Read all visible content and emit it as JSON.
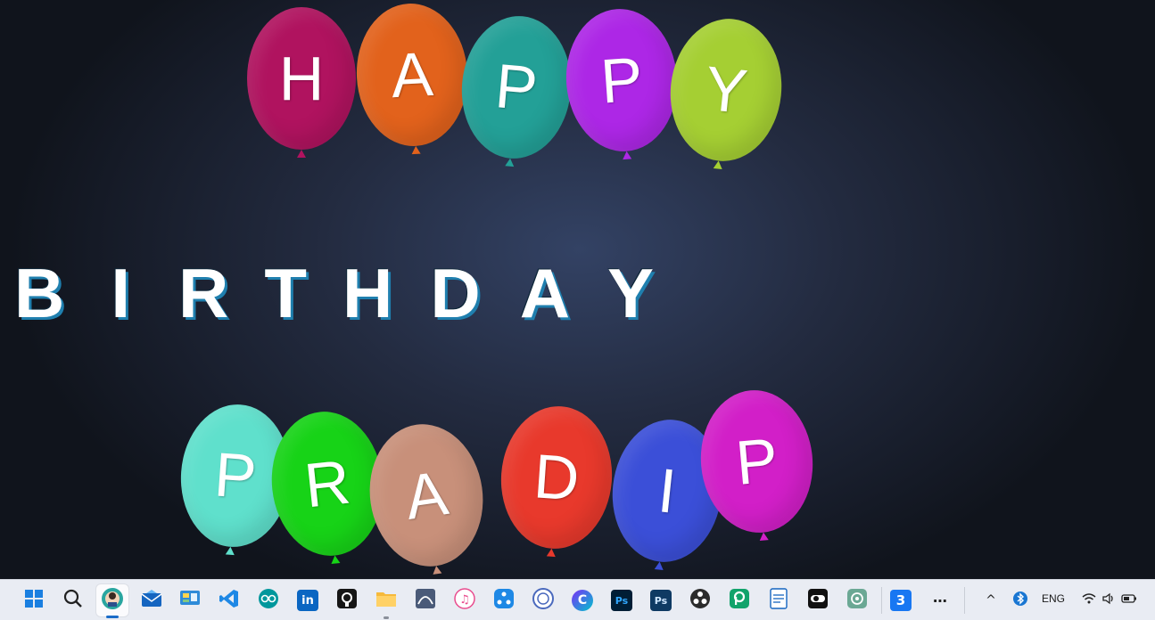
{
  "greeting": {
    "top_word": [
      {
        "letter": "H",
        "color": "#b0135f"
      },
      {
        "letter": "A",
        "color": "#e2621c"
      },
      {
        "letter": "P",
        "color": "#23a097"
      },
      {
        "letter": "P",
        "color": "#ad27e6"
      },
      {
        "letter": "Y",
        "color": "#a5cf33"
      }
    ],
    "middle_word": [
      "B",
      "I",
      "R",
      "T",
      "H",
      "D",
      "A",
      "Y"
    ],
    "bottom_word": [
      {
        "letter": "P",
        "color": "#5fe0cc"
      },
      {
        "letter": "R",
        "color": "#17d317"
      },
      {
        "letter": "A",
        "color": "#c8907a"
      },
      {
        "letter": "D",
        "color": "#e8392c"
      },
      {
        "letter": "I",
        "color": "#3b4fd8"
      },
      {
        "letter": "P",
        "color": "#d21fc8"
      }
    ]
  },
  "taskbar": {
    "apps": [
      {
        "name": "start-icon"
      },
      {
        "name": "search-icon"
      },
      {
        "name": "edge-profile-icon",
        "active": true
      },
      {
        "name": "mail-icon"
      },
      {
        "name": "control-panel-icon"
      },
      {
        "name": "vscode-icon"
      },
      {
        "name": "arduino-icon"
      },
      {
        "name": "linkedin-icon",
        "glyph": "in"
      },
      {
        "name": "github-icon"
      },
      {
        "name": "file-explorer-icon",
        "running": true
      },
      {
        "name": "wireshark-icon"
      },
      {
        "name": "itunes-icon"
      },
      {
        "name": "shareit-icon"
      },
      {
        "name": "seal-app-icon"
      },
      {
        "name": "canva-icon",
        "glyph": "C"
      },
      {
        "name": "photoshop-icon",
        "glyph": "Ps"
      },
      {
        "name": "photoshop-classic-icon",
        "glyph": "Ps"
      },
      {
        "name": "obs-icon"
      },
      {
        "name": "picsart-icon"
      },
      {
        "name": "notepad-icon"
      },
      {
        "name": "toggle-app-icon"
      },
      {
        "name": "chatgpt-icon"
      },
      {
        "name": "threads-app-icon",
        "glyph": "3"
      },
      {
        "name": "more-icon",
        "glyph": "⋯"
      }
    ],
    "tray": {
      "chevron": "^",
      "language": "ENG"
    }
  }
}
